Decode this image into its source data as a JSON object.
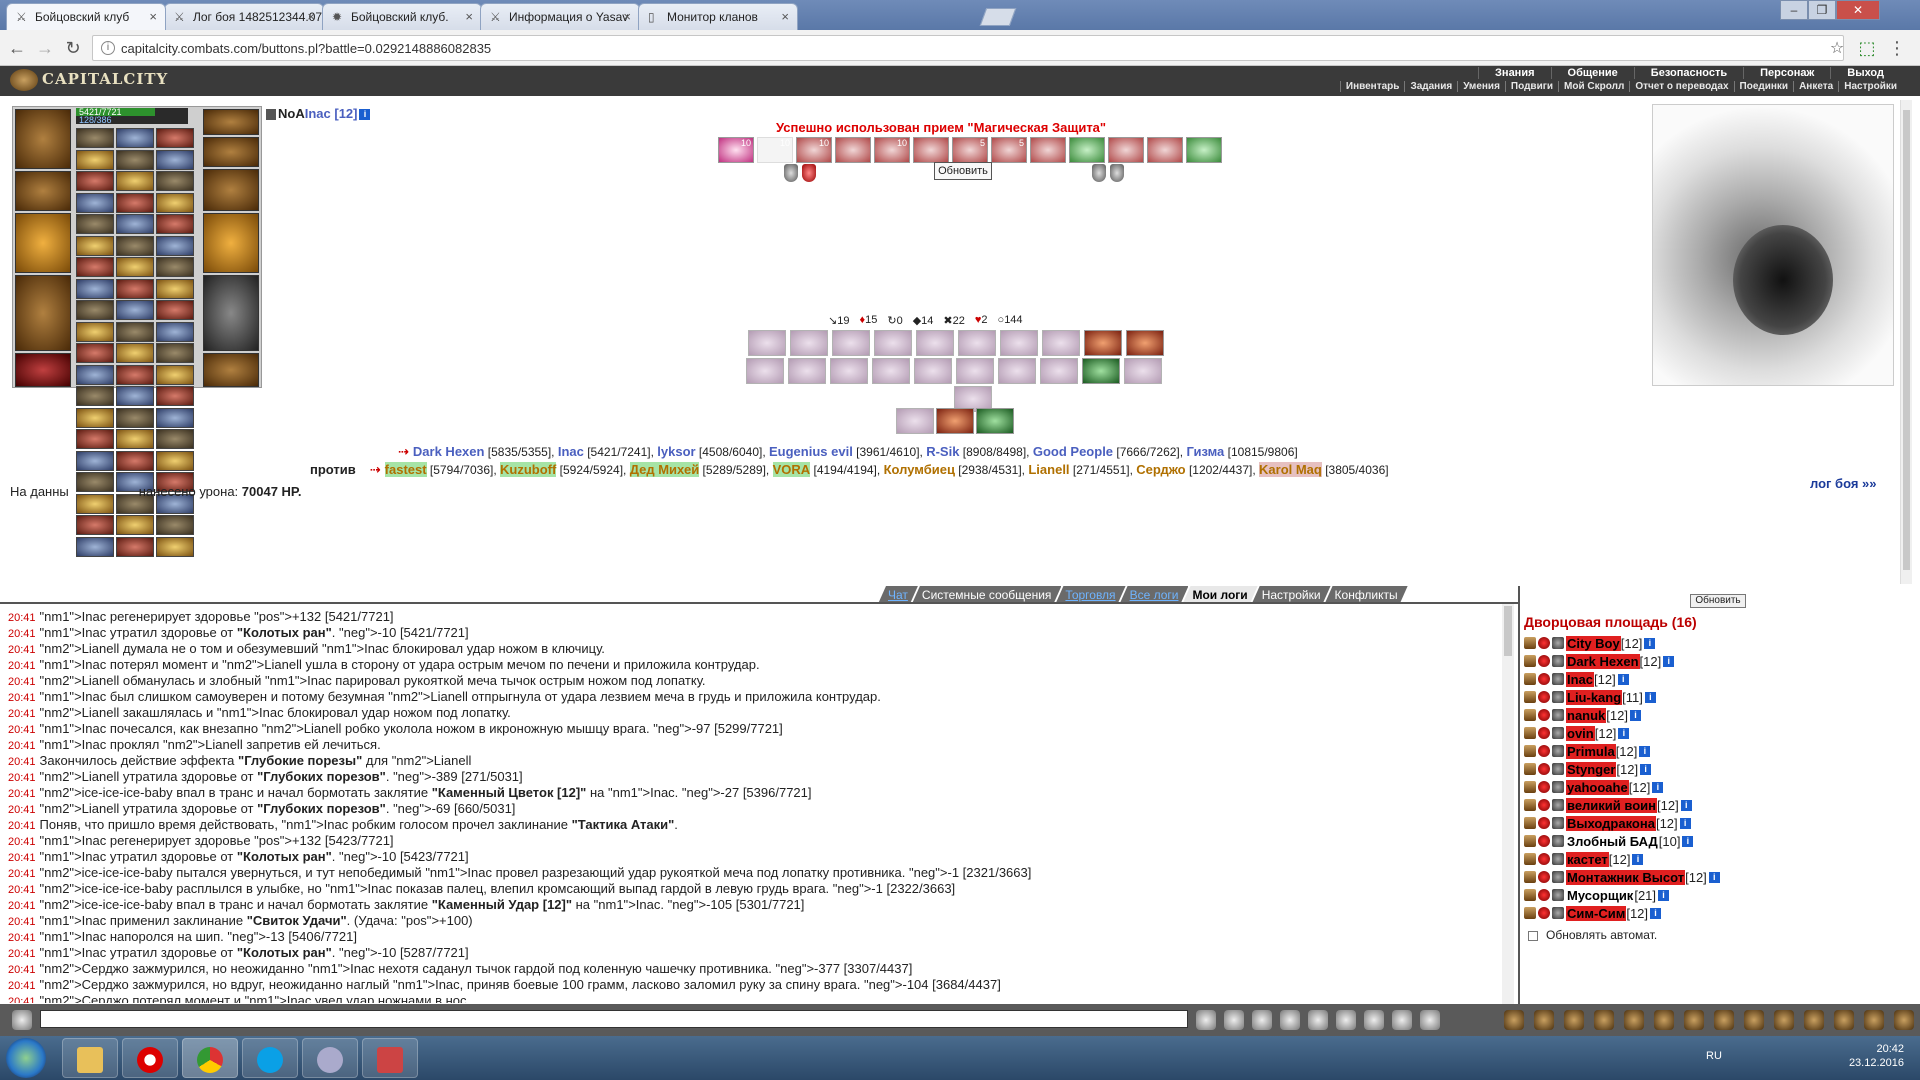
{
  "browser": {
    "tabs": [
      {
        "title": "Бойцовский клуб",
        "active": true,
        "icon": "swords-icon"
      },
      {
        "title": "Лог боя 1482512344.07",
        "active": false,
        "icon": "swords-icon"
      },
      {
        "title": "Бойцовский клуб.",
        "active": false,
        "icon": "fire-icon"
      },
      {
        "title": "Информация о Yasav",
        "active": false,
        "icon": "swords-icon"
      },
      {
        "title": "Монитор кланов",
        "active": false,
        "icon": "page-icon"
      }
    ],
    "url": "capitalcity.combats.com/buttons.pl?battle=0.0292148886082835"
  },
  "header": {
    "logo": "CAPITALCITY",
    "nav": [
      "Знания",
      "Общение",
      "Безопасность",
      "Персонаж",
      "Выход"
    ],
    "subnav": [
      "Инвентарь",
      "Задания",
      "Умения",
      "Подвиги",
      "Мой Скролл",
      "Отчет о переводах",
      "Поединки",
      "Анкета",
      "Настройки"
    ]
  },
  "player": {
    "hp": "5421/7721",
    "mana": "128/386",
    "hp_fraction": 0.702,
    "clan": "NoA",
    "name": "Inac",
    "level": "[12]"
  },
  "battle": {
    "success_message": "Успешно использован прием \"Магическая Защита\"",
    "refresh": "Обновить",
    "counters": [
      "19",
      "15",
      "0",
      "14",
      "22",
      "2",
      "144"
    ],
    "status_labels": [
      "10",
      "10",
      "10",
      "",
      "10",
      "",
      "5",
      "5",
      "",
      ""
    ],
    "team1": [
      {
        "name": "Dark Hexen",
        "hp": "[5835/5355]"
      },
      {
        "name": "Inac",
        "hp": "[5421/7241]"
      },
      {
        "name": "lyksor",
        "hp": "[4508/6040]"
      },
      {
        "name": "Eugenius evil",
        "hp": "[3961/4610]"
      },
      {
        "name": "R-Sik",
        "hp": "[8908/8498]"
      },
      {
        "name": "Good People",
        "hp": "[7666/7262]"
      },
      {
        "name": "Гизма",
        "hp": "[10815/9806]"
      }
    ],
    "against": "против",
    "team2": [
      {
        "name": "fastest",
        "hp": "[5794/7036]"
      },
      {
        "name": "Kuzuboff",
        "hp": "[5924/5924]"
      },
      {
        "name": "Дед Михей",
        "hp": "[5289/5289]"
      },
      {
        "name": "VORA",
        "hp": "[4194/4194]"
      },
      {
        "name": "Колумбиец",
        "hp": "[2938/4531]"
      },
      {
        "name": "Lianell",
        "hp": "[271/4551]"
      },
      {
        "name": "Серджо",
        "hp": "[1202/4437]"
      },
      {
        "name": "Karol Maq",
        "hp": "[3805/4036]"
      }
    ],
    "damage_prefix": "На данны",
    "damage_mid": "нанесено урона:",
    "damage_value": "70047 HP.",
    "log_link": "лог боя »»"
  },
  "chat": {
    "tabs": [
      "Чат",
      "Системные сообщения",
      "Торговля",
      "Все логи",
      "Мои логи",
      "Настройки",
      "Конфликты"
    ],
    "active_tab": "Мои логи",
    "lines": [
      "Inac регенерирует здоровье +132 [5421/7721]",
      "Inac утратил здоровье от \"Колотых ран\". -10 [5421/7721]",
      "Lianell думала не о том и обезумевший Inac блокировал удар ножом в ключицу.",
      "Inac потерял момент и Lianell ушла в сторону от удара острым мечом по печени и приложила контрудар.",
      "Lianell обманулась и злобный Inac парировал рукояткой меча тычок острым ножом под лопатку.",
      "Inac был слишком самоуверен и потому безумная Lianell отпрыгнула от удара лезвием меча в грудь и приложила контрудар.",
      "Lianell закашлялась и Inac блокировал удар ножом под лопатку.",
      "Inac почесался, как внезапно Lianell робко уколола ножом в икроножную мышцу врага. -97 [5299/7721]",
      "Inac проклял Lianell запретив ей лечиться.",
      "Закончилось действие эффекта \"Глубокие порезы\" для Lianell",
      "Lianell утратила здоровье от \"Глубоких порезов\". -389 [271/5031]",
      "ice-ice-ice-baby впал в транс и начал бормотать заклятие \"Каменный Цветок [12]\" на Inac. -27 [5396/7721]",
      "Lianell утратила здоровье от \"Глубоких порезов\". -69 [660/5031]",
      "Поняв, что пришло время действовать, Inac робким голосом прочел заклинание \"Тактика Атаки\".",
      "Inac регенерирует здоровье +132 [5423/7721]",
      "Inac утратил здоровье от \"Колотых ран\". -10 [5423/7721]",
      "ice-ice-ice-baby пытался увернуться, и тут непобедимый Inac провел разрезающий удар рукояткой меча под лопатку противника. -1 [2321/3663]",
      "ice-ice-ice-baby расплылся в улыбке, но Inac показав палец, влепил кромсающий выпад гардой в левую грудь врага. -1 [2322/3663]",
      "ice-ice-ice-baby впал в транс и начал бормотать заклятие \"Каменный Удар [12]\" на Inac. -105 [5301/7721]",
      "Inac применил заклинание \"Свиток Удачи\". (Удача: +100)",
      "Inac напоролся на шип. -13 [5406/7721]",
      "Inac утратил здоровье от \"Колотых ран\". -10 [5287/7721]",
      "Серджо зажмурился, но неожиданно Inac нехотя саданул тычок гардой под коленную чашечку противника. -377 [3307/4437]",
      "Серджо зажмурился, но вдруг, неожиданно наглый Inac, приняв боевые 100 грамм, ласково заломил руку за спину врага. -104 [3684/4437]",
      "Серджо потерял момент и Inac увел удар ножнами в нос"
    ],
    "time": "20:41"
  },
  "room": {
    "refresh": "Обновить",
    "title": "Дворцовая площадь (16)",
    "players": [
      {
        "name": "City Boy",
        "level": "[12]",
        "highlight": true
      },
      {
        "name": "Dark Hexen",
        "level": "[12]",
        "highlight": true
      },
      {
        "name": "Inac",
        "level": "[12]",
        "highlight": true
      },
      {
        "name": "Liu-kang",
        "level": "[11]",
        "highlight": true
      },
      {
        "name": "nanuk",
        "level": "[12]",
        "highlight": true
      },
      {
        "name": "ovin",
        "level": "[12]",
        "highlight": true
      },
      {
        "name": "Primula",
        "level": "[12]",
        "highlight": true
      },
      {
        "name": "Stynger",
        "level": "[12]",
        "highlight": true
      },
      {
        "name": "yahooahe",
        "level": "[12]",
        "highlight": true
      },
      {
        "name": "великий воин",
        "level": "[12]",
        "highlight": true
      },
      {
        "name": "Выходракона",
        "level": "[12]",
        "highlight": true
      },
      {
        "name": "Злобный БАД",
        "level": "[10]",
        "highlight": false
      },
      {
        "name": "кастет",
        "level": "[12]",
        "highlight": true
      },
      {
        "name": "Монтажник Высот",
        "level": "[12]",
        "highlight": true
      },
      {
        "name": "Мусорщик",
        "level": "[21]",
        "highlight": false
      },
      {
        "name": "Сим-Сим",
        "level": "[12]",
        "highlight": true
      }
    ],
    "auto_refresh": "Обновлять автомат."
  },
  "taskbar": {
    "lang": "RU",
    "time": "20:42",
    "date": "23.12.2016"
  }
}
